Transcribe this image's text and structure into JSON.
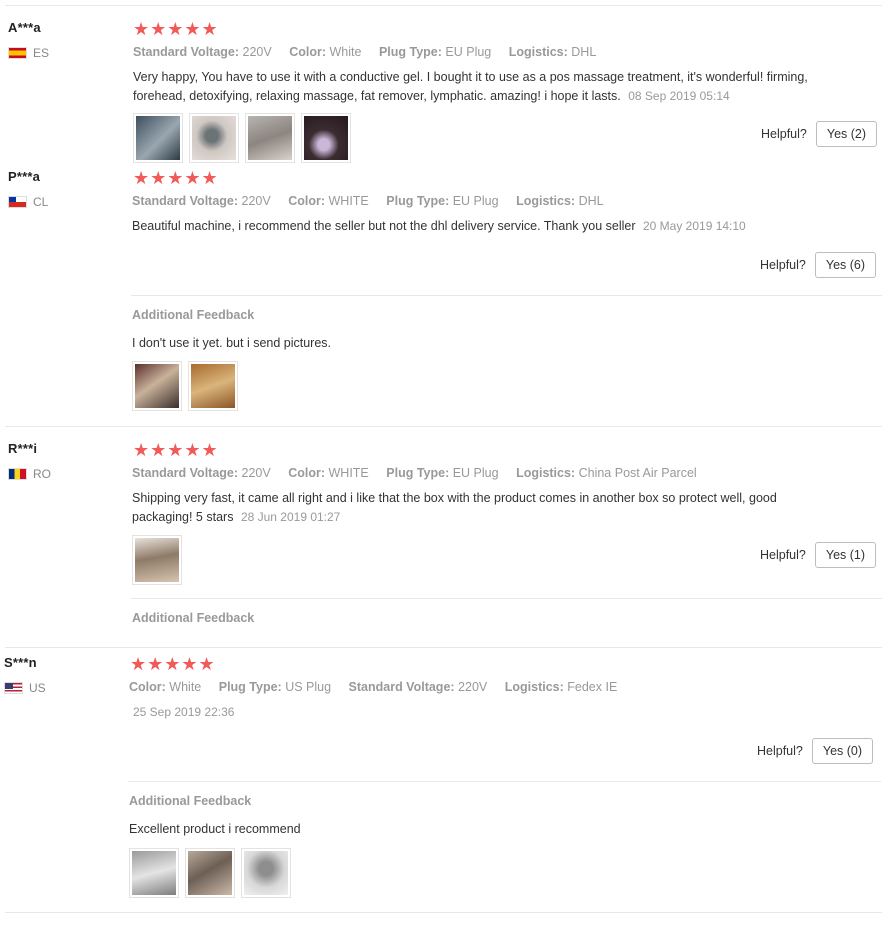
{
  "helpful_label": "Helpful?",
  "attr_labels": {
    "voltage": "Standard Voltage:",
    "color": "Color:",
    "plug": "Plug Type:",
    "logistics": "Logistics:"
  },
  "additional_feedback_label": "Additional Feedback",
  "star_color": "#f25a5a",
  "reviews": [
    {
      "buyer": "A***a",
      "country": "ES",
      "rating": 5,
      "stars": "★★★★★",
      "voltage": "220V",
      "color": "White",
      "plug": "EU Plug",
      "logistics": "DHL",
      "text": "Very happy, You have to use it with a conductive gel. I bought it to use as a pos massage treatment, it's wonderful! firming, forehead, detoxifying, relaxing massage, fat remover, lymphatic. amazing! i hope it lasts.",
      "date": "08 Sep 2019 05:14",
      "helpful": "Yes (2)",
      "photos": [
        "product-photo",
        "product-photo",
        "product-photo",
        "product-photo"
      ]
    },
    {
      "buyer": "P***a",
      "country": "CL",
      "rating": 5,
      "stars": "★★★★★",
      "voltage": "220V",
      "color": "WHITE",
      "plug": "EU Plug",
      "logistics": "DHL",
      "text": "Beautiful machine, i recommend the seller but not the dhl delivery service. Thank you seller",
      "date": "20 May 2019 14:10",
      "helpful": "Yes (6)",
      "additional_text": "I don't use it yet. but i send pictures.",
      "additional_photos": [
        "product-photo",
        "product-photo"
      ]
    },
    {
      "buyer": "R***i",
      "country": "RO",
      "rating": 5,
      "stars": "★★★★★",
      "voltage": "220V",
      "color": "WHITE",
      "plug": "EU Plug",
      "logistics": "China Post Air Parcel",
      "text": "Shipping very fast, it came all right and i like that the box with the product comes in another box so protect well, good packaging! 5 stars",
      "date": "28 Jun 2019 01:27",
      "helpful": "Yes (1)",
      "photos": [
        "product-photo"
      ]
    },
    {
      "buyer": "S***n",
      "country": "US",
      "rating": 5,
      "stars": "★★★★★",
      "color": "White",
      "plug": "US Plug",
      "voltage": "220V",
      "logistics": "Fedex IE",
      "date": "25 Sep 2019 22:36",
      "helpful": "Yes (0)",
      "additional_text": "Excellent product i recommend",
      "additional_photos": [
        "product-photo",
        "product-photo",
        "product-photo"
      ]
    }
  ]
}
